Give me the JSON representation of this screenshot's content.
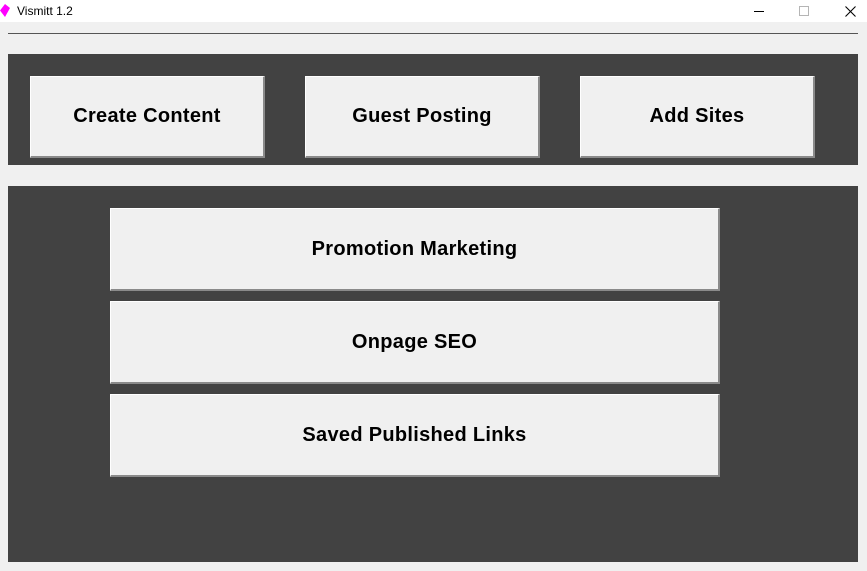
{
  "window": {
    "title": "Vismitt 1.2",
    "icon": "app-icon",
    "controls": [
      "minimize-icon",
      "maximize-icon",
      "close-icon"
    ]
  },
  "top_panel": {
    "buttons": [
      {
        "label": "Create Content"
      },
      {
        "label": "Guest Posting"
      },
      {
        "label": "Add Sites"
      }
    ]
  },
  "bottom_panel": {
    "buttons": [
      {
        "label": "Promotion Marketing"
      },
      {
        "label": "Onpage SEO"
      },
      {
        "label": "Saved Published Links"
      }
    ]
  },
  "colors": {
    "panel_bg": "#424242",
    "window_bg": "#f0f0f0",
    "button_bg": "#f0f0f0",
    "app_icon": "#ff00ff"
  }
}
